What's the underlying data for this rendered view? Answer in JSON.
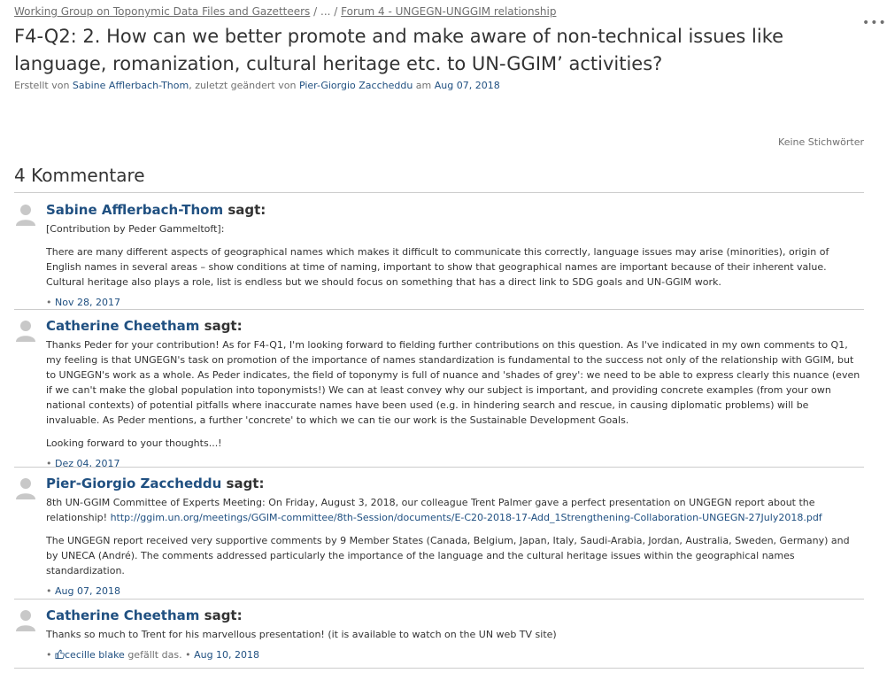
{
  "breadcrumbs": {
    "space": "Working Group on Toponymic Data Files and Gazetteers",
    "ellipsis": "/ ... /",
    "parent": "Forum 4 - UNGEGN-UNGGIM relationship"
  },
  "more_actions": "•••",
  "page": {
    "title": "F4-Q2: 2. How can we better promote and make aware of non-technical issues like language, romanization, cultural heritage etc. to UN-GGIM’ activities?",
    "byline": {
      "created_by_prefix": "Erstellt von",
      "creator": "Sabine Afflerbach-Thom",
      "modified_prefix": ", zuletzt geändert von",
      "modifier": "Pier-Giorgio Zaccheddu",
      "date_prefix": "am",
      "date": "Aug 07, 2018"
    },
    "labels": "Keine Stichwörter"
  },
  "comments_heading": "4 Kommentare",
  "comments": [
    {
      "author": "Sabine Afflerbach-Thom",
      "says": "sagt:",
      "paragraphs": [
        "[Contribution by Peder Gammeltoft]:",
        "There are many different aspects of geographical names which makes it difficult to communicate this correctly, language issues may arise (minorities), origin of English names in several areas – show conditions at time of naming, important to show that geographical names are important because of their inherent value. Cultural heritage also plays a role, list is endless but we should focus on something that has a direct link to SDG goals and UN-GGIM work."
      ],
      "date": "Nov 28, 2017"
    },
    {
      "author": "Catherine Cheetham",
      "says": "sagt:",
      "paragraphs": [
        "Thanks Peder for your contribution! As for F4-Q1, I'm looking forward to fielding further contributions on this question.  As I've indicated in my own comments to Q1, my feeling is that UNGEGN's task on promotion of the importance of names standardization is fundamental to the success not only of the relationship with GGIM, but to UNGEGN's work as a whole.  As Peder indicates, the field of toponymy is full of nuance and 'shades of grey': we need to be able to express clearly this nuance (even if we can't make the global population into toponymists!) We can at least convey why our subject is important, and providing concrete examples (from your own national contexts) of potential pitfalls where inaccurate names have been used (e.g. in hindering search and rescue, in causing diplomatic problems) will be invaluable.  As Peder mentions, a further 'concrete' to which we can tie our work is the Sustainable Development Goals.",
        "Looking forward to your thoughts...!"
      ],
      "date": "Dez 04, 2017"
    },
    {
      "author": "Pier-Giorgio Zaccheddu",
      "says": "sagt:",
      "p1_text": "8th UN-GGIM Committee of Experts Meeting:  On Friday, August 3, 2018, our colleague Trent Palmer gave a perfect presentation on UNGEGN report about the relationship! ",
      "p1_link": "http://ggim.un.org/meetings/GGIM-committee/8th-Session/documents/E-C20-2018-17-Add_1Strengthening-Collaboration-UNGEGN-27July2018.pdf",
      "p2": "The UNGEGN report received very supportive comments by 9 Member States (Canada, Belgium, Japan, Italy, Saudi-Arabia, Jordan, Australia, Sweden, Germany) and by UNECA (André). The comments addressed particularly the importance of the language and the cultural heritage issues within the geographical names standardization.",
      "date": "Aug 07, 2018"
    },
    {
      "author": "Catherine Cheetham",
      "says": "sagt:",
      "paragraphs": [
        "Thanks so much to Trent for his marvellous presentation! (it is available to watch on the UN web TV site)"
      ],
      "liker": "cecille blake",
      "likes_suffix": "gefällt das.",
      "date": "Aug 10, 2018"
    }
  ],
  "meta_separator": "•",
  "icons": {
    "avatar": "default-user-avatar-icon",
    "like": "thumbs-up-icon",
    "more": "more-actions-icon"
  },
  "colors": {
    "link": "#205081",
    "text": "#333333",
    "muted": "#707070",
    "rule": "#cccccc",
    "avatar": "#c8c8c8"
  }
}
